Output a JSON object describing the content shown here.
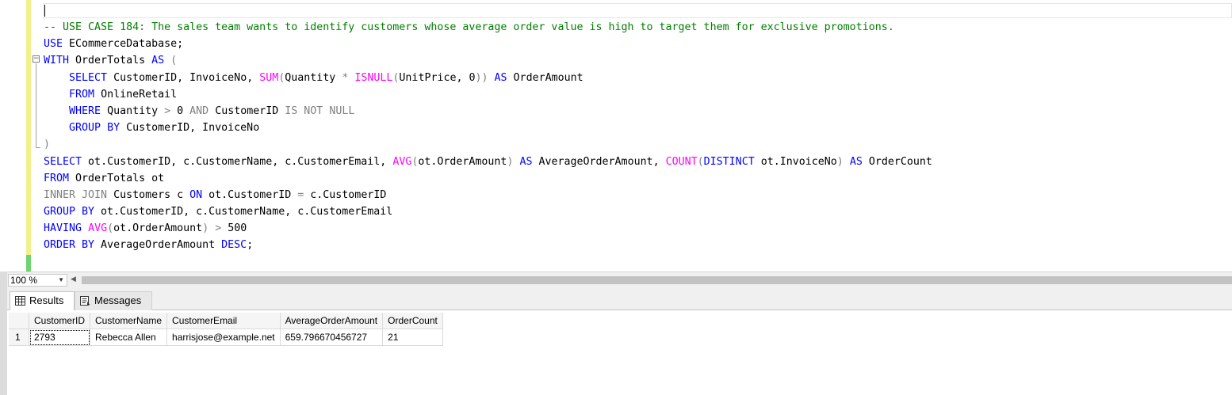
{
  "editor": {
    "lines": [
      [
        {
          "c": "cm",
          "t": "-- USE CASE 184: The sales team wants to identify customers whose average order value is high to target them for exclusive promotions."
        }
      ],
      [
        {
          "c": "kw",
          "t": "USE"
        },
        {
          "c": "pl",
          "t": " ECommerceDatabase;"
        }
      ],
      [
        {
          "c": "kw",
          "t": "WITH"
        },
        {
          "c": "pl",
          "t": " OrderTotals "
        },
        {
          "c": "kw",
          "t": "AS"
        },
        {
          "c": "pl",
          "t": " "
        },
        {
          "c": "op",
          "t": "("
        }
      ],
      [
        {
          "c": "pl",
          "t": "    "
        },
        {
          "c": "kw",
          "t": "SELECT"
        },
        {
          "c": "pl",
          "t": " CustomerID, InvoiceNo, "
        },
        {
          "c": "fn",
          "t": "SUM"
        },
        {
          "c": "op",
          "t": "("
        },
        {
          "c": "pl",
          "t": "Quantity "
        },
        {
          "c": "op",
          "t": "*"
        },
        {
          "c": "pl",
          "t": " "
        },
        {
          "c": "fn",
          "t": "ISNULL"
        },
        {
          "c": "op",
          "t": "("
        },
        {
          "c": "pl",
          "t": "UnitPrice, 0"
        },
        {
          "c": "op",
          "t": "))"
        },
        {
          "c": "pl",
          "t": " "
        },
        {
          "c": "kw",
          "t": "AS"
        },
        {
          "c": "pl",
          "t": " OrderAmount"
        }
      ],
      [
        {
          "c": "pl",
          "t": "    "
        },
        {
          "c": "kw",
          "t": "FROM"
        },
        {
          "c": "pl",
          "t": " OnlineRetail"
        }
      ],
      [
        {
          "c": "pl",
          "t": "    "
        },
        {
          "c": "kw",
          "t": "WHERE"
        },
        {
          "c": "pl",
          "t": " Quantity "
        },
        {
          "c": "op",
          "t": ">"
        },
        {
          "c": "pl",
          "t": " 0 "
        },
        {
          "c": "op",
          "t": "AND"
        },
        {
          "c": "pl",
          "t": " CustomerID "
        },
        {
          "c": "op",
          "t": "IS NOT NULL"
        }
      ],
      [
        {
          "c": "pl",
          "t": "    "
        },
        {
          "c": "kw",
          "t": "GROUP BY"
        },
        {
          "c": "pl",
          "t": " CustomerID, InvoiceNo"
        }
      ],
      [
        {
          "c": "op",
          "t": ")"
        }
      ],
      [
        {
          "c": "kw",
          "t": "SELECT"
        },
        {
          "c": "pl",
          "t": " ot.CustomerID, c.CustomerName, c.CustomerEmail, "
        },
        {
          "c": "fn",
          "t": "AVG"
        },
        {
          "c": "op",
          "t": "("
        },
        {
          "c": "pl",
          "t": "ot.OrderAmount"
        },
        {
          "c": "op",
          "t": ")"
        },
        {
          "c": "pl",
          "t": " "
        },
        {
          "c": "kw",
          "t": "AS"
        },
        {
          "c": "pl",
          "t": " AverageOrderAmount, "
        },
        {
          "c": "fn",
          "t": "COUNT"
        },
        {
          "c": "op",
          "t": "("
        },
        {
          "c": "kw",
          "t": "DISTINCT"
        },
        {
          "c": "pl",
          "t": " ot.InvoiceNo"
        },
        {
          "c": "op",
          "t": ")"
        },
        {
          "c": "pl",
          "t": " "
        },
        {
          "c": "kw",
          "t": "AS"
        },
        {
          "c": "pl",
          "t": " OrderCount"
        }
      ],
      [
        {
          "c": "kw",
          "t": "FROM"
        },
        {
          "c": "pl",
          "t": " OrderTotals ot"
        }
      ],
      [
        {
          "c": "op",
          "t": "INNER JOIN"
        },
        {
          "c": "pl",
          "t": " Customers c "
        },
        {
          "c": "kw",
          "t": "ON"
        },
        {
          "c": "pl",
          "t": " ot.CustomerID "
        },
        {
          "c": "op",
          "t": "="
        },
        {
          "c": "pl",
          "t": " c.CustomerID"
        }
      ],
      [
        {
          "c": "kw",
          "t": "GROUP BY"
        },
        {
          "c": "pl",
          "t": " ot.CustomerID, c.CustomerName, c.CustomerEmail"
        }
      ],
      [
        {
          "c": "kw",
          "t": "HAVING"
        },
        {
          "c": "pl",
          "t": " "
        },
        {
          "c": "fn",
          "t": "AVG"
        },
        {
          "c": "op",
          "t": "("
        },
        {
          "c": "pl",
          "t": "ot.OrderAmount"
        },
        {
          "c": "op",
          "t": ")"
        },
        {
          "c": "pl",
          "t": " "
        },
        {
          "c": "op",
          "t": ">"
        },
        {
          "c": "pl",
          "t": " 500"
        }
      ],
      [
        {
          "c": "kw",
          "t": "ORDER BY"
        },
        {
          "c": "pl",
          "t": " AverageOrderAmount "
        },
        {
          "c": "kw",
          "t": "DESC"
        },
        {
          "c": "pl",
          "t": ";"
        }
      ]
    ]
  },
  "zoom": {
    "value": "100 %"
  },
  "tabs": {
    "results": "Results",
    "messages": "Messages"
  },
  "grid": {
    "columns": [
      "CustomerID",
      "CustomerName",
      "CustomerEmail",
      "AverageOrderAmount",
      "OrderCount"
    ],
    "rows": [
      {
        "num": "1",
        "cells": [
          "2793",
          "Rebecca Allen",
          "harrisjose@example.net",
          "659.796670456727",
          "21"
        ]
      }
    ]
  },
  "colors": {
    "keyword": "#0000ff",
    "function": "#ff00ff",
    "operator": "#808080",
    "comment": "#008000"
  }
}
